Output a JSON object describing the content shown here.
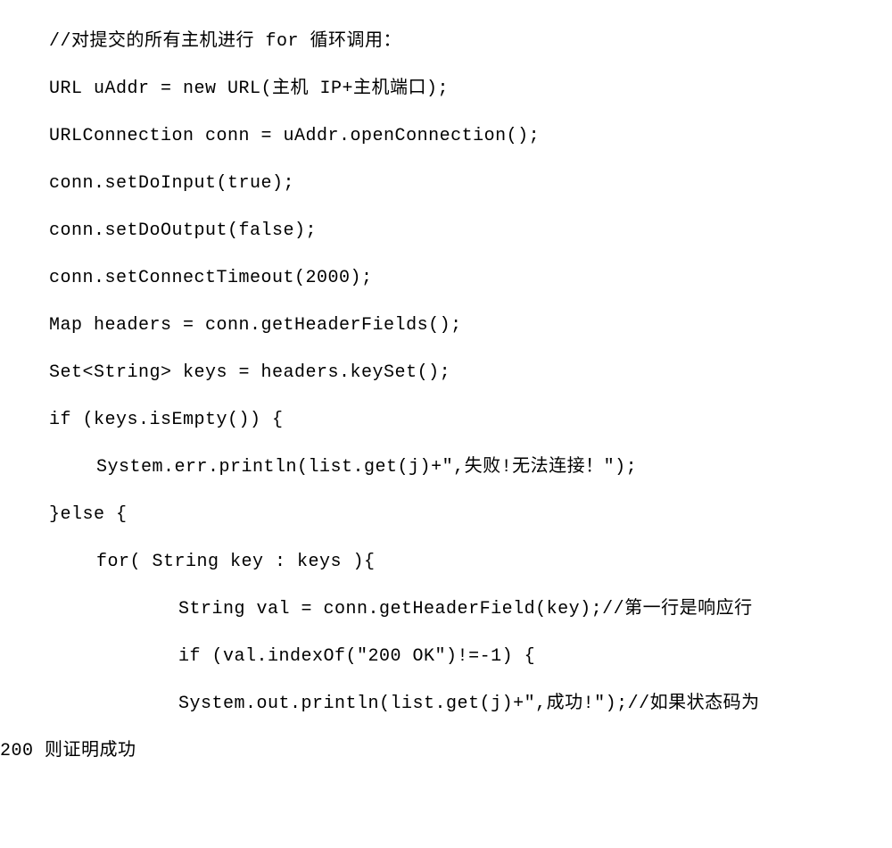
{
  "code": {
    "lines": [
      "//对提交的所有主机进行 for 循环调用：",
      "URL uAddr = new URL(主机 IP+主机端口);",
      "URLConnection conn = uAddr.openConnection();",
      "conn.setDoInput(true);",
      "conn.setDoOutput(false);",
      "conn.setConnectTimeout(2000);",
      "Map headers = conn.getHeaderFields();",
      "Set<String> keys = headers.keySet();",
      "if (keys.isEmpty()) {",
      "  System.err.println(list.get(j)+\",失败!无法连接！\");",
      "}else {",
      "  for( String key : keys ){",
      "      String val = conn.getHeaderField(key);//第一行是响应行",
      "      if (val.indexOf(\"200 OK\")!=-1) {",
      "      System.out.println(list.get(j)+\",成功!\");//如果状态码为",
      "200 则证明成功"
    ]
  }
}
